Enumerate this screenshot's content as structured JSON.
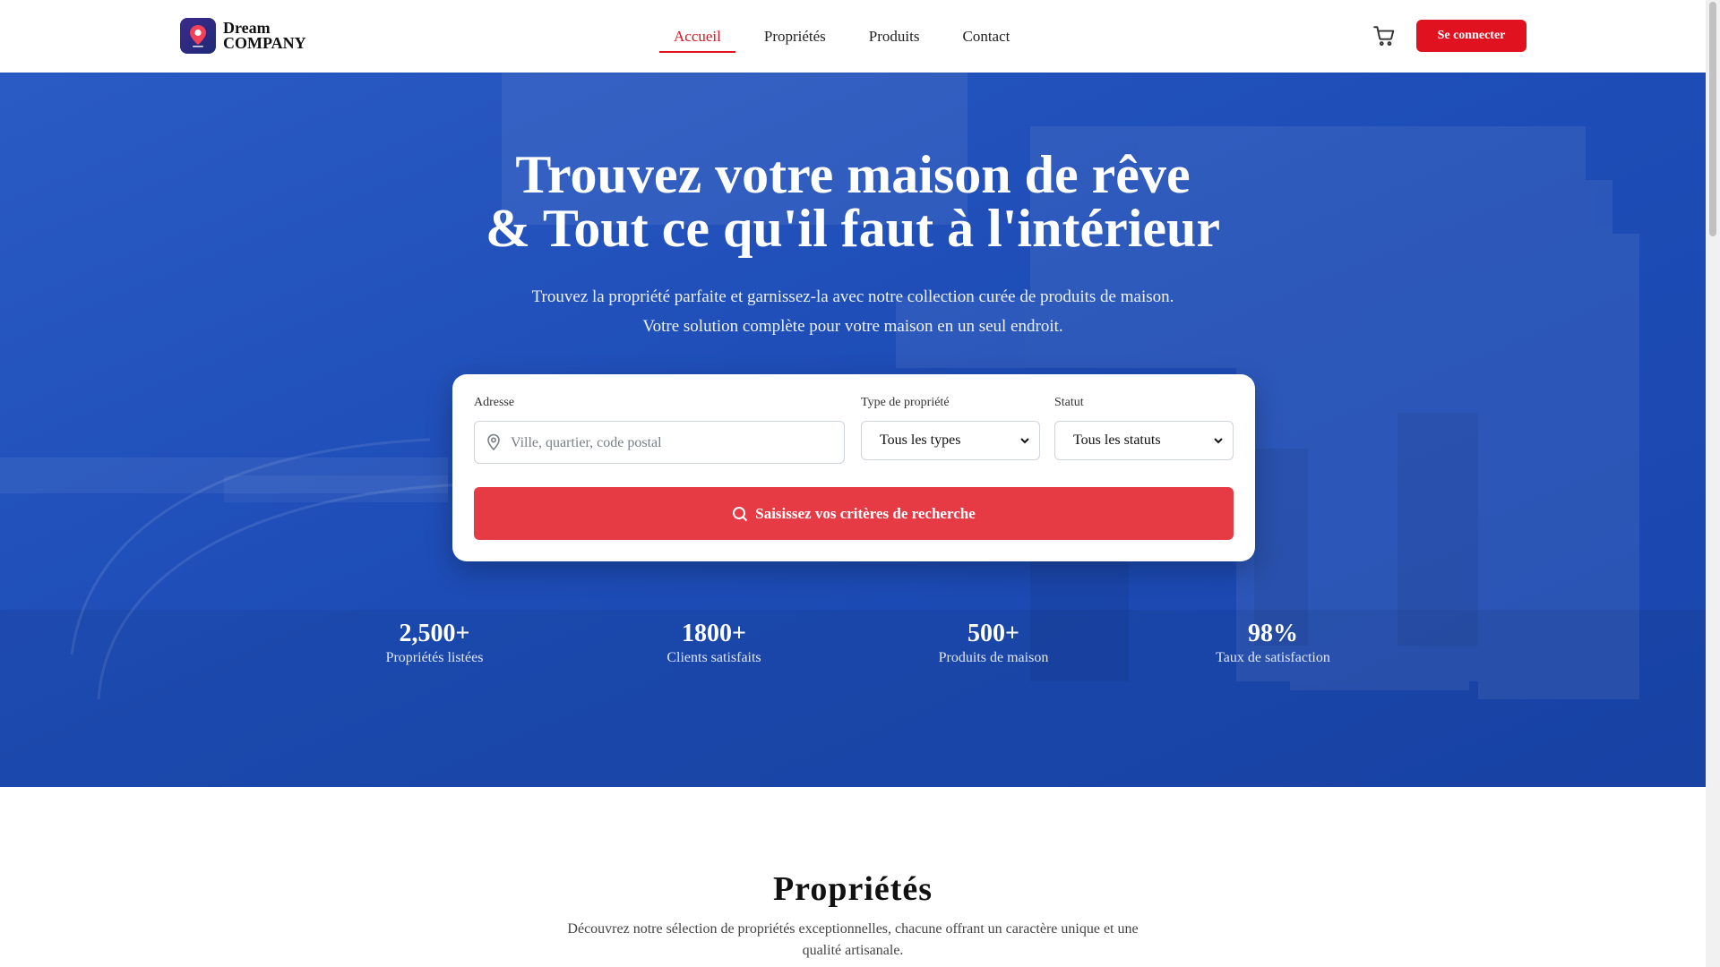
{
  "header": {
    "logo_line1": "Dream",
    "logo_line2": "COMPANY",
    "nav": [
      "Accueil",
      "Propriétés",
      "Produits",
      "Contact"
    ],
    "active_nav": "Accueil",
    "login_label": "Se connecter"
  },
  "hero": {
    "title_line1": "Trouvez votre maison de rêve",
    "title_line2": "& Tout ce qu'il faut à l'intérieur",
    "subtitle_line1": "Trouvez la propriété parfaite et garnissez-la avec notre collection curée de produits de maison.",
    "subtitle_line2": "Votre solution complète pour votre maison en un seul endroit."
  },
  "search": {
    "address_label": "Adresse",
    "address_placeholder": "Ville, quartier, code postal",
    "address_value": "",
    "type_label": "Type de propriété",
    "type_value": "Tous les types",
    "status_label": "Statut",
    "status_value": "Tous les statuts",
    "button_label": "Saisissez vos critères de recherche"
  },
  "stats": [
    {
      "value": "2,500+",
      "label": "Propriétés listées"
    },
    {
      "value": "1800+",
      "label": "Clients satisfaits"
    },
    {
      "value": "500+",
      "label": "Produits de maison"
    },
    {
      "value": "98%",
      "label": "Taux de satisfaction"
    }
  ],
  "properties": {
    "title": "Propriétés",
    "description": "Découvrez notre sélection de propriétés exceptionnelles, chacune offrant un caractère unique et une qualité artisanale."
  },
  "colors": {
    "accent": "#e1121f",
    "hero_blue": "#1e4db7",
    "search_button": "#e63a44"
  },
  "icons": {
    "cart": "shopping-cart-icon",
    "pin": "map-pin-icon",
    "search": "search-icon",
    "chevron": "chevron-down-icon"
  }
}
